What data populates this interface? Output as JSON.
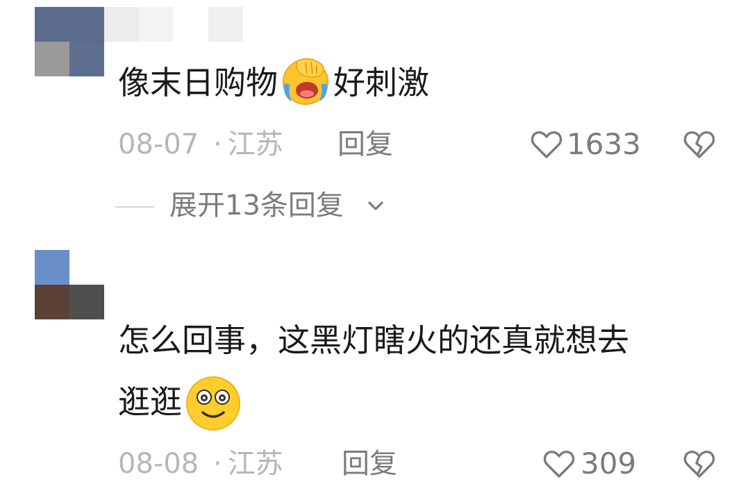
{
  "comments": [
    {
      "text_before": "像末日购物",
      "emoji": "facepalm-crying-emoji",
      "text_after": "好刺激",
      "date": "08-07",
      "separator": "·",
      "location": "江苏",
      "reply_label": "回复",
      "likes": "1633",
      "expand_label": "展开13条回复"
    },
    {
      "text_line1": "怎么回事，这黑灯瞎火的还真就想去",
      "text_line2": "逛逛",
      "emoji": "wide-eyed-smile-emoji",
      "date": "08-08",
      "separator": "·",
      "location": "江苏",
      "reply_label": "回复",
      "likes": "309"
    }
  ],
  "icons": {
    "like": "heart-outline-icon",
    "dislike": "broken-heart-icon",
    "expand": "chevron-down-icon"
  },
  "colors": {
    "text_primary": "#1a1a1a",
    "text_meta": "#b6b6b6",
    "text_secondary": "#7b7b7b"
  }
}
